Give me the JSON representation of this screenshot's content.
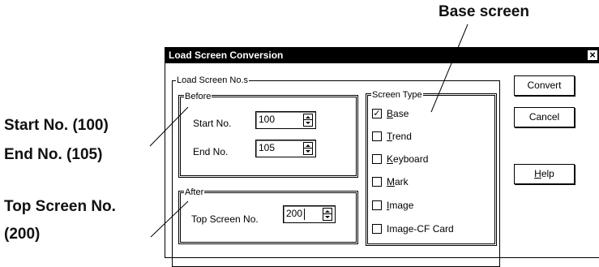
{
  "callouts": {
    "base_screen": "Base screen",
    "start_no": "Start No. (100)",
    "end_no": "End No. (105)",
    "top_screen_line1": "Top Screen No.",
    "top_screen_line2": "(200)"
  },
  "dialog": {
    "title": "Load Screen Conversion",
    "close_glyph": "×",
    "load_group_title": "Load Screen No.s",
    "before_title": "Before",
    "start_label": "Start No.",
    "start_value": "100",
    "end_label": "End No.",
    "end_value": "105",
    "after_title": "After",
    "top_label": "Top Screen No.",
    "top_value": "200",
    "screen_type_title": "Screen Type",
    "screen_types": [
      {
        "first": "B",
        "rest": "ase",
        "checked": true
      },
      {
        "first": "T",
        "rest": "rend",
        "checked": false
      },
      {
        "first": "K",
        "rest": "eyboard",
        "checked": false
      },
      {
        "first": "M",
        "rest": "ark",
        "checked": false
      },
      {
        "first": "I",
        "rest": "mage",
        "checked": false
      },
      {
        "first": "I",
        "rest": "mage-CF Card",
        "checked": false
      }
    ],
    "buttons": {
      "convert": "Convert",
      "cancel": "Cancel",
      "help_first": "H",
      "help_rest": "elp"
    }
  }
}
